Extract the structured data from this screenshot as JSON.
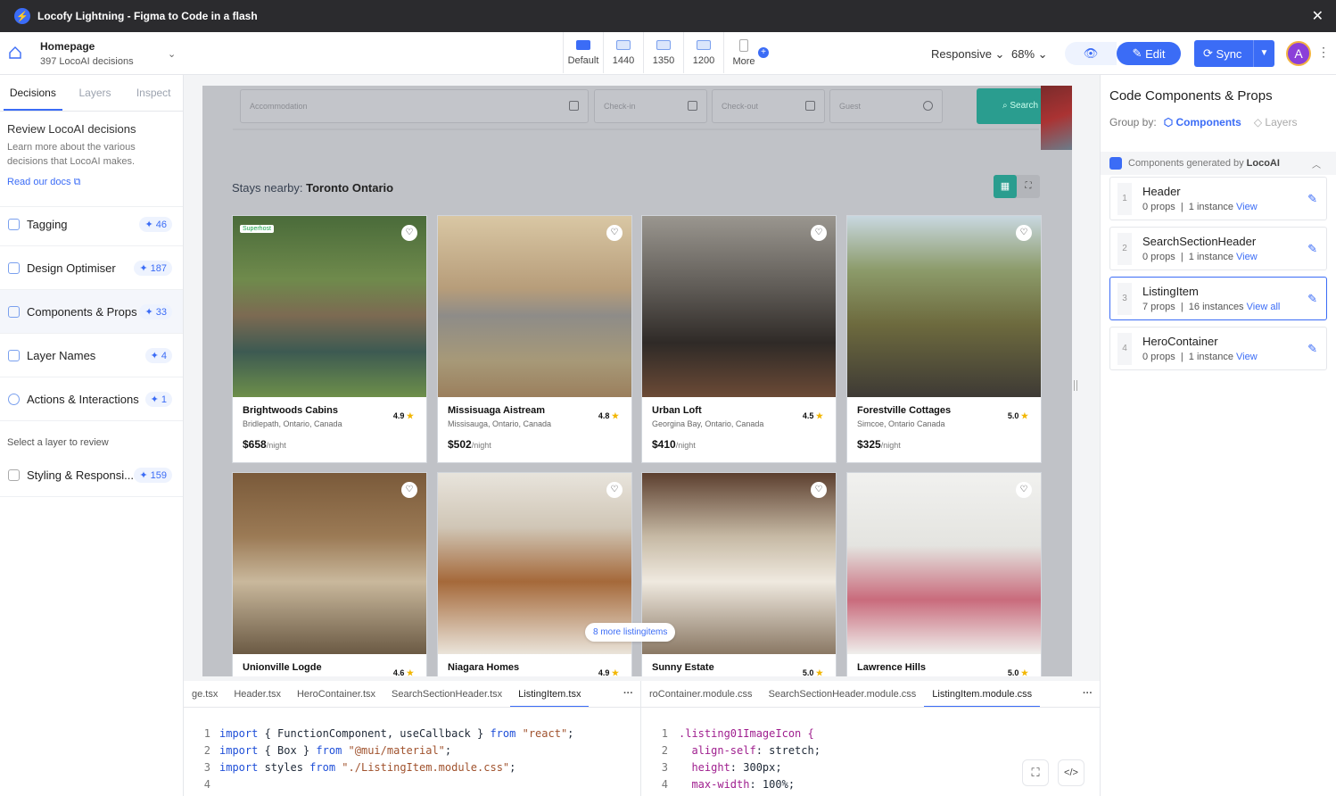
{
  "titlebar": {
    "title": "Locofy Lightning - Figma to Code in a flash"
  },
  "project": {
    "name": "Homepage",
    "decisions": "397 LocoAI decisions"
  },
  "devices": [
    {
      "label": "Default",
      "selected": true
    },
    {
      "label": "1440"
    },
    {
      "label": "1350"
    },
    {
      "label": "1200"
    },
    {
      "label": "More"
    }
  ],
  "toolbar": {
    "responsive": "Responsive",
    "zoom": "68%",
    "edit": "Edit",
    "sync": "Sync",
    "avatar": "A"
  },
  "left": {
    "tabs": [
      "Decisions",
      "Layers",
      "Inspect"
    ],
    "review_title": "Review LocoAI decisions",
    "review_text": "Learn more about the various decisions that LocoAI makes.",
    "docs_link": "Read our docs",
    "items": [
      {
        "label": "Tagging",
        "count": "46"
      },
      {
        "label": "Design Optimiser",
        "count": "187"
      },
      {
        "label": "Components & Props",
        "count": "33"
      },
      {
        "label": "Layer Names",
        "count": "4"
      },
      {
        "label": "Actions & Interactions",
        "count": "1"
      }
    ],
    "select_layer": "Select a layer to review",
    "styling": {
      "label": "Styling & Responsi...",
      "count": "159"
    }
  },
  "canvas": {
    "search": {
      "accommodation": "Accommodation",
      "checkin": "Check-in",
      "checkout": "Check-out",
      "guest": "Guest",
      "button": "Search"
    },
    "stays_prefix": "Stays nearby: ",
    "stays_city": "Toronto Ontario",
    "more_items": "8 more listingitems",
    "cards": [
      {
        "name": "Brightwoods Cabins",
        "loc": "Bridlepath, Ontario, Canada",
        "rating": "4.9",
        "price": "$658",
        "unit": "/night",
        "badge": "Superhost",
        "img": "linear-gradient(180deg,#4a6b3a 0%,#6f8a4c 35%,#7c6a52 55%,#3d5a52 75%,#6d8f4a 100%)"
      },
      {
        "name": "Missisuaga Aistream",
        "loc": "Missisauga, Ontario, Canada",
        "rating": "4.8",
        "price": "$502",
        "unit": "/night",
        "img": "linear-gradient(180deg,#d9c7a4 0%,#b79d7a 40%,#8e8c88 55%,#a79978 80%,#9b7f5d 100%)"
      },
      {
        "name": "Urban Loft",
        "loc": "Georgina Bay, Ontario, Canada",
        "rating": "4.5",
        "price": "$410",
        "unit": "/night",
        "img": "linear-gradient(180deg,#9a968f 0%,#5f5b56 40%,#2f2a27 70%,#6b4a36 100%)"
      },
      {
        "name": "Forestville Cottages",
        "loc": "Simcoe, Ontario Canada",
        "rating": "5.0",
        "price": "$325",
        "unit": "/night",
        "img": "linear-gradient(180deg,#c9d8e0 0%,#8c9b6a 30%,#6d6a3e 60%,#3e3a35 100%)"
      },
      {
        "name": "Unionville Logde",
        "rating": "4.6",
        "img": "linear-gradient(180deg,#7a5a3a 0%,#9b7a55 35%,#c9b89c 60%,#6b5a44 100%)"
      },
      {
        "name": "Niagara Homes",
        "rating": "4.9",
        "img": "linear-gradient(180deg,#e8e4dc 0%,#d0c6b6 30%,#a5693a 60%,#eae4da 100%)"
      },
      {
        "name": "Sunny Estate",
        "rating": "5.0",
        "img": "linear-gradient(180deg,#5c3f2f 0%,#c6b9a4 35%,#efe9df 60%,#8a7864 100%)"
      },
      {
        "name": "Lawrence Hills",
        "rating": "5.0",
        "img": "linear-gradient(180deg,#f1f1ef 0%,#e4e4e0 40%,#c96b7c 70%,#efefec 100%)"
      }
    ]
  },
  "right": {
    "title": "Code Components & Props",
    "group_by": "Group by:",
    "group_components": "Components",
    "group_layers": "Layers",
    "generated": "Components generated by",
    "generated_ai": "LocoAI",
    "components": [
      {
        "no": "1",
        "name": "Header",
        "props": "0 props",
        "inst": "1 instance",
        "view": "View"
      },
      {
        "no": "2",
        "name": "SearchSectionHeader",
        "props": "0 props",
        "inst": "1 instance",
        "view": "View"
      },
      {
        "no": "3",
        "name": "ListingItem",
        "props": "7 props",
        "inst": "16 instances",
        "view": "View all",
        "active": true
      },
      {
        "no": "4",
        "name": "HeroContainer",
        "props": "0 props",
        "inst": "1 instance",
        "view": "View"
      }
    ]
  },
  "code_left": {
    "tabs": [
      "ge.tsx",
      "Header.tsx",
      "HeroContainer.tsx",
      "SearchSectionHeader.tsx",
      "ListingItem.tsx"
    ],
    "lines": [
      "1",
      "2",
      "3",
      "4"
    ],
    "code": [
      [
        "import",
        " { FunctionComponent, useCallback } ",
        "from",
        " ",
        "\"react\"",
        ";"
      ],
      [
        "import",
        " { Box } ",
        "from",
        " ",
        "\"@mui/material\"",
        ";"
      ],
      [
        "import",
        " styles ",
        "from",
        " ",
        "\"./ListingItem.module.css\"",
        ";"
      ],
      [
        "",
        "",
        "",
        "",
        "",
        ""
      ]
    ]
  },
  "code_right": {
    "tabs": [
      "roContainer.module.css",
      "SearchSectionHeader.module.css",
      "ListingItem.module.css"
    ],
    "lines": [
      "1",
      "2",
      "3",
      "4"
    ],
    "code": [
      [
        ".listing01ImageIcon {",
        "",
        ""
      ],
      [
        "  align-self",
        ": stretch;",
        ""
      ],
      [
        "  height",
        ": 300px;",
        ""
      ],
      [
        "  max-width",
        ": 100%;",
        ""
      ]
    ]
  }
}
